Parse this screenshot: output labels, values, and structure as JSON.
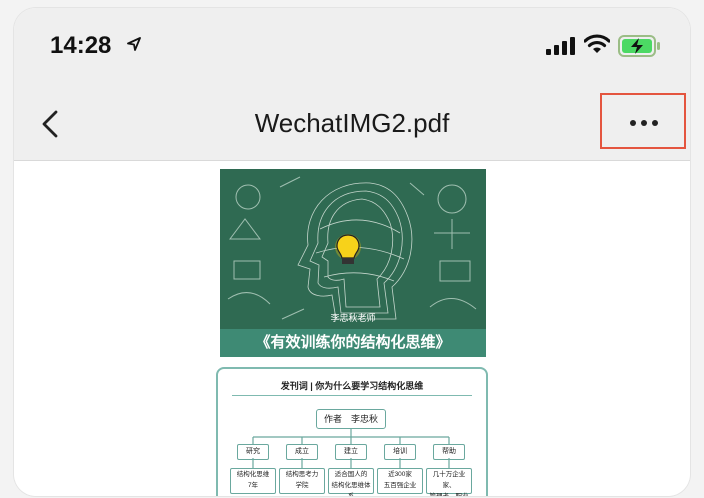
{
  "status_bar": {
    "time": "14:28",
    "icons": [
      "location-arrow-icon",
      "cellular-signal-icon",
      "wifi-icon",
      "battery-charging-icon"
    ]
  },
  "nav": {
    "title": "WechatIMG2.pdf",
    "back_icon": "chevron-left-icon",
    "more_icon": "ellipsis-icon",
    "highlight_color": "#e4553f"
  },
  "document": {
    "cover_author": "李忠秋老师",
    "book_title": "《有效训练你的结构化思维》",
    "mindmap": {
      "title": "发刊词 | 你为什么要学习结构化思维",
      "root": "作者　李忠秋",
      "branches": [
        {
          "label": "研究",
          "leaf": "结构化思维\n7年"
        },
        {
          "label": "成立",
          "leaf": "结构思考力\n学院"
        },
        {
          "label": "建立",
          "leaf": "适合国人的\n结构化思维体系"
        },
        {
          "label": "培训",
          "leaf": "近300家\n五百强企业"
        },
        {
          "label": "帮助",
          "leaf": "几十万企业家、\n管理者、职业人"
        }
      ]
    },
    "colors": {
      "cover_green": "#2f6a52",
      "banner_teal": "#3e8a74",
      "mindmap_border": "#7fbab0"
    }
  }
}
